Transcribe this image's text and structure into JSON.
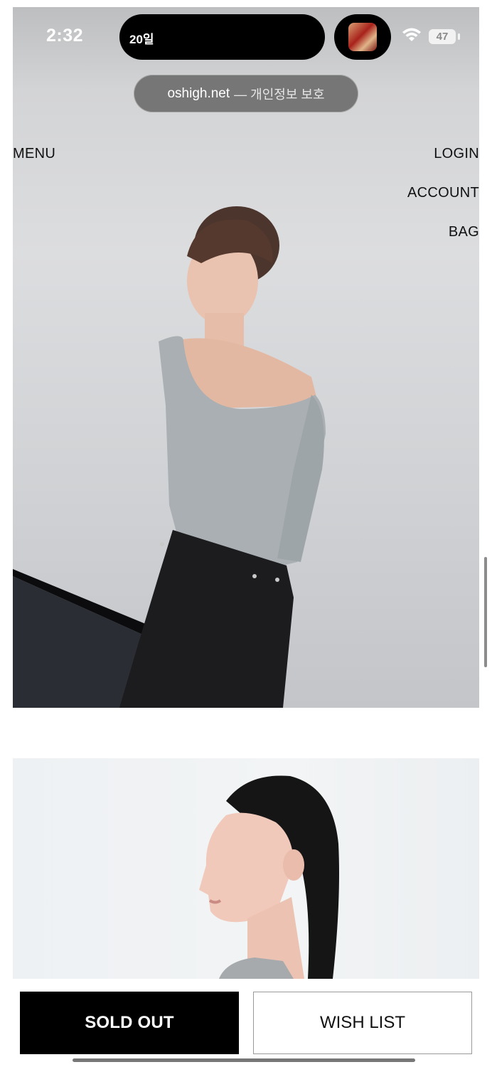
{
  "status_bar": {
    "time": "2:32",
    "live_activity_text": "20일",
    "battery_level": "47",
    "wifi_icon": "wifi-icon",
    "album_icon": "now-playing-artwork"
  },
  "browser": {
    "domain": "oshigh.net",
    "privacy_note": "— 개인정보 보호"
  },
  "nav": {
    "menu": "MENU",
    "login": "LOGIN",
    "account": "ACCOUNT",
    "bag": "BAG"
  },
  "actions": {
    "sold_out": "SOLD OUT",
    "wish_list": "WISH LIST"
  },
  "colors": {
    "primary_button_bg": "#000000",
    "primary_button_text": "#ffffff",
    "secondary_button_border": "#9a9a9a"
  }
}
